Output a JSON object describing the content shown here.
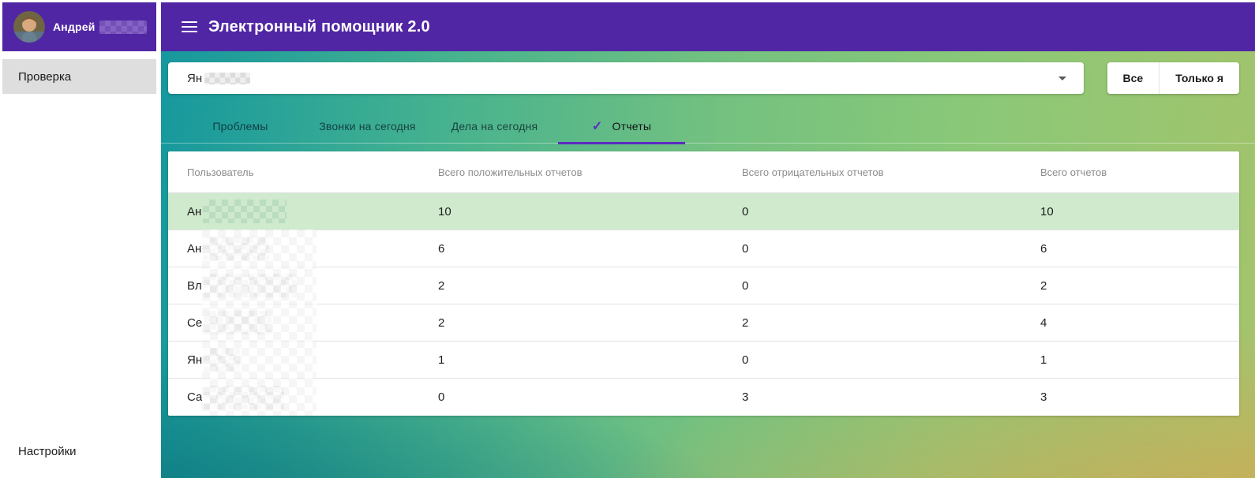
{
  "sidebar": {
    "user": {
      "name": "Андрей",
      "surname_blurred": true
    },
    "items": [
      {
        "label": "Проверка",
        "active": true
      }
    ],
    "settings_label": "Настройки"
  },
  "appbar": {
    "title": "Электронный помощник 2.0",
    "menu_icon": "hamburger-icon"
  },
  "filter": {
    "select_value_prefix": "Ян",
    "select_value_blurred": true,
    "dropdown_icon": "chevron-down-icon",
    "all_label": "Все",
    "only_me_label": "Только я"
  },
  "tabs": [
    {
      "label": "Проблемы",
      "active": false
    },
    {
      "label": "Звонки на сегодня",
      "active": false
    },
    {
      "label": "Дела на сегодня",
      "active": false
    },
    {
      "label": "Отчеты",
      "active": true,
      "check_icon": "check-icon"
    }
  ],
  "table": {
    "columns": [
      "Пользователь",
      "Всего положительных отчетов",
      "Всего отрицательных отчетов",
      "Всего отчетов"
    ],
    "rows": [
      {
        "user_prefix": "Ан",
        "name_blurred": true,
        "blur_width": 106,
        "positive": "10",
        "negative": "0",
        "total": "10",
        "highlighted": true
      },
      {
        "user_prefix": "Ан",
        "name_blurred": true,
        "blur_width": 84,
        "positive": "6",
        "negative": "0",
        "total": "6",
        "highlighted": false
      },
      {
        "user_prefix": "Вл",
        "name_blurred": true,
        "blur_width": 118,
        "positive": "2",
        "negative": "0",
        "total": "2",
        "highlighted": false
      },
      {
        "user_prefix": "Се",
        "name_blurred": true,
        "blur_width": 86,
        "positive": "2",
        "negative": "2",
        "total": "4",
        "highlighted": false
      },
      {
        "user_prefix": "Ян",
        "name_blurred": true,
        "blur_width": 46,
        "positive": "1",
        "negative": "0",
        "total": "1",
        "highlighted": false
      },
      {
        "user_prefix": "Са",
        "name_blurred": true,
        "blur_width": 102,
        "positive": "0",
        "negative": "3",
        "total": "3",
        "highlighted": false
      }
    ]
  },
  "colors": {
    "appbar_purple": "#5126a5",
    "accent_purple": "#5b2bc0",
    "row_highlight_green": "#cfeacd",
    "bg_gradient_teal": "#16989e",
    "bg_gradient_green": "#74c180",
    "bg_gradient_gold": "#d6a652",
    "sidebar_item_gray": "#dedede"
  }
}
